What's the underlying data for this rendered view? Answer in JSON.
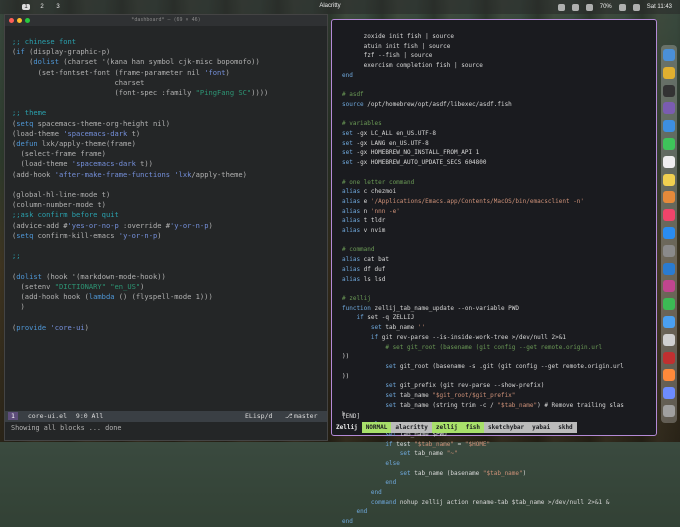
{
  "menubar": {
    "workspaces": [
      "1",
      "2",
      "3"
    ],
    "active_workspace": "1",
    "app_title": "Alacritty",
    "clock": "Sat 11:43",
    "battery": "70%"
  },
  "emacs": {
    "title": "*dashboard* — (69 × 46)",
    "modeline": {
      "window_number": "1",
      "buffer": "core-ui.el",
      "position": "9:0 All",
      "major_mode": "ELisp/d",
      "branch": "master"
    },
    "minibuffer": "Showing all blocks ... done",
    "code_lines": [
      ";; chinese font",
      "(if (display-graphic-p)",
      "    (dolist (charset '(kana han symbol cjk-misc bopomofo))",
      "      (set-fontset-font (frame-parameter nil 'font)",
      "                        charset",
      "                        (font-spec :family \"PingFang SC\"))))",
      "",
      ";; theme",
      "(setq spacemacs-theme-org-height nil)",
      "(load-theme 'spacemacs-dark t)",
      "(defun lxk/apply-theme(frame)",
      "  (select-frame frame)",
      "  (load-theme 'spacemacs-dark t))",
      "(add-hook 'after-make-frame-functions 'lxk/apply-theme)",
      "",
      "(global-hl-line-mode t)",
      "(column-number-mode t)",
      ";;ask confirm before quit",
      "(advice-add #'yes-or-no-p :override #'y-or-n-p)",
      "(setq confirm-kill-emacs 'y-or-n-p)",
      "",
      ";;",
      "",
      "(dolist (hook '(markdown-mode-hook))",
      "  (setenv \"DICTIONARY\" \"en_US\")",
      "  (add-hook hook (lambda () (flyspell-mode 1)))",
      "  )",
      "",
      "(provide 'core-ui)"
    ]
  },
  "terminal": {
    "code_lines": [
      "      zoxide init fish | source",
      "      atuin init fish | source",
      "      fzf --fish | source",
      "      exercism completion fish | source",
      "end",
      "",
      "# asdf",
      "source /opt/homebrew/opt/asdf/libexec/asdf.fish",
      "",
      "# variables",
      "set -gx LC_ALL en_US.UTF-8",
      "set -gx LANG en_US.UTF-8",
      "set -gx HOMEBREW_NO_INSTALL_FROM_API 1",
      "set -gx HOMEBREW_AUTO_UPDATE_SECS 604800",
      "",
      "# one letter command",
      "alias c chezmoi",
      "alias e '/Applications/Emacs.app/Contents/MacOS/bin/emacsclient -n'",
      "alias n 'nnn -e'",
      "alias t tldr",
      "alias v nvim",
      "",
      "# command",
      "alias cat bat",
      "alias df duf",
      "alias ls lsd",
      "",
      "# zellij",
      "function zellij_tab_name_update --on-variable PWD",
      "    if set -q ZELLIJ",
      "        set tab_name ''",
      "        if git rev-parse --is-inside-work-tree >/dev/null 2>&1",
      "            # set git_root (basename (git config --get remote.origin.url",
      "))",
      "            set git_root (basename -s .git (git config --get remote.origin.url",
      "))",
      "            set git_prefix (git rev-parse --show-prefix)",
      "            set tab_name \"$git_root/$git_prefix\"",
      "            set tab_name (string trim -c / \"$tab_name\") # Remove trailing slas",
      "h",
      "        else",
      "            set tab_name $PWD",
      "            if test \"$tab_name\" = \"$HOME\"",
      "                set tab_name \"~\"",
      "            else",
      "                set tab_name (basename \"$tab_name\")",
      "            end",
      "        end",
      "        command nohup zellij action rename-tab $tab_name >/dev/null 2>&1 &",
      "    end",
      "end"
    ],
    "mode_indicator": "[END]",
    "tabs": [
      {
        "label": "Zellij",
        "bg": "#1a1b1f",
        "fg": "#eeeeee"
      },
      {
        "label": "NORMAL",
        "bg": "#a8e06a",
        "fg": "#1a1b1f"
      },
      {
        "label": "alacritty",
        "bg": "#bbbbbb",
        "fg": "#1a1b1f"
      },
      {
        "label": "zellij",
        "bg": "#a8e06a",
        "fg": "#1a1b1f"
      },
      {
        "label": "fish",
        "bg": "#a8e06a",
        "fg": "#1a1b1f"
      },
      {
        "label": "sketchybar",
        "bg": "#bbbbbb",
        "fg": "#1a1b1f"
      },
      {
        "label": "yabai",
        "bg": "#bbbbbb",
        "fg": "#1a1b1f"
      },
      {
        "label": "skhd",
        "bg": "#bbbbbb",
        "fg": "#1a1b1f"
      }
    ]
  },
  "dock": {
    "icons": [
      {
        "name": "finder-icon",
        "color": "#4a90d9"
      },
      {
        "name": "chrome-icon",
        "color": "#e0b030"
      },
      {
        "name": "terminal-icon",
        "color": "#333333"
      },
      {
        "name": "emacs-icon",
        "color": "#7a5cb0"
      },
      {
        "name": "mail-icon",
        "color": "#3d8fe0"
      },
      {
        "name": "messages-icon",
        "color": "#3ec45a"
      },
      {
        "name": "calendar-icon",
        "color": "#eeeeee"
      },
      {
        "name": "notes-icon",
        "color": "#f0d050"
      },
      {
        "name": "photos-icon",
        "color": "#e58a3a"
      },
      {
        "name": "music-icon",
        "color": "#f0446a"
      },
      {
        "name": "appstore-icon",
        "color": "#2a8cf0"
      },
      {
        "name": "settings-icon",
        "color": "#8a8a8a"
      },
      {
        "name": "vscode-icon",
        "color": "#2a7bd0"
      },
      {
        "name": "slack-icon",
        "color": "#c0458e"
      },
      {
        "name": "wechat-icon",
        "color": "#3cba54"
      },
      {
        "name": "safari-icon",
        "color": "#4aa0f0"
      },
      {
        "name": "preview-icon",
        "color": "#d0d0d0"
      },
      {
        "name": "zotero-icon",
        "color": "#c03030"
      },
      {
        "name": "reminders-icon",
        "color": "#ff8a3a"
      },
      {
        "name": "downloads-icon",
        "color": "#6d8cff"
      },
      {
        "name": "trash-icon",
        "color": "#a0a0a0"
      }
    ]
  }
}
